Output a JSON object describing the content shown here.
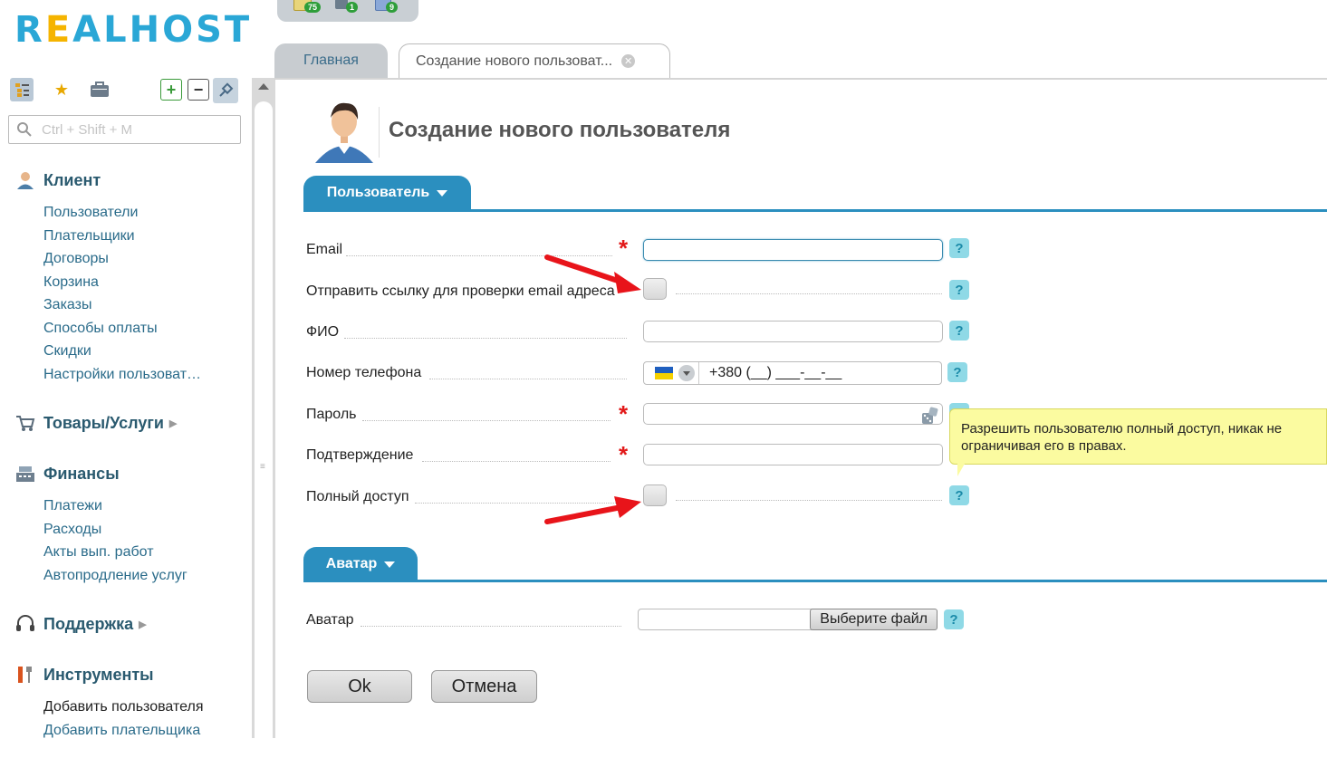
{
  "brand": {
    "logo_text_a": "R",
    "logo_text_b": "E",
    "logo_text_c": "ALHOST"
  },
  "notifications": [
    {
      "icon": "mail-icon",
      "count": "75"
    },
    {
      "icon": "users-icon",
      "count": "1"
    },
    {
      "icon": "tasks-icon",
      "count": "9"
    }
  ],
  "sidebar": {
    "search_placeholder": "Ctrl + Shift + M",
    "groups": [
      {
        "label": "Клиент",
        "icon": "client-icon",
        "items": [
          "Пользователи",
          "Плательщики",
          "Договоры",
          "Корзина",
          "Заказы",
          "Способы оплаты",
          "Скидки",
          "Настройки пользоват…"
        ]
      },
      {
        "label": "Товары/Услуги",
        "icon": "cart-icon",
        "collapsed": true
      },
      {
        "label": "Финансы",
        "icon": "cash-register-icon",
        "items": [
          "Платежи",
          "Расходы",
          "Акты вып. работ",
          "Автопродление услуг"
        ]
      },
      {
        "label": "Поддержка",
        "icon": "headset-icon",
        "collapsed": true
      },
      {
        "label": "Инструменты",
        "icon": "tools-icon",
        "items": [
          "Добавить пользователя",
          "Добавить плательщика"
        ]
      }
    ]
  },
  "tabs": [
    {
      "label": "Главная",
      "active": false
    },
    {
      "label": "Создание нового пользоват...",
      "active": true
    }
  ],
  "page": {
    "title": "Создание нового пользователя"
  },
  "sections": {
    "user": "Пользователь",
    "avatar": "Аватар"
  },
  "form": {
    "email_label": "Email",
    "send_link_label": "Отправить ссылку для проверки email адреса",
    "fio_label": "ФИО",
    "phone_label": "Номер телефона",
    "phone_value": "+380 (__) ___-__-__",
    "password_label": "Пароль",
    "confirm_label": "Подтверждение",
    "full_access_label": "Полный доступ",
    "avatar_label": "Аватар",
    "file_button": "Выберите файл",
    "required_mark": "*",
    "help_mark": "?"
  },
  "tooltip": {
    "text": "Разрешить пользователю полный доступ, никак не ограничивая его в правах."
  },
  "buttons": {
    "ok": "Ok",
    "cancel": "Отмена"
  },
  "colors": {
    "accent": "#2b8fbf",
    "required": "#e21a1a",
    "annotation_arrow": "#e8141a",
    "tooltip_bg": "#fbfba0"
  }
}
